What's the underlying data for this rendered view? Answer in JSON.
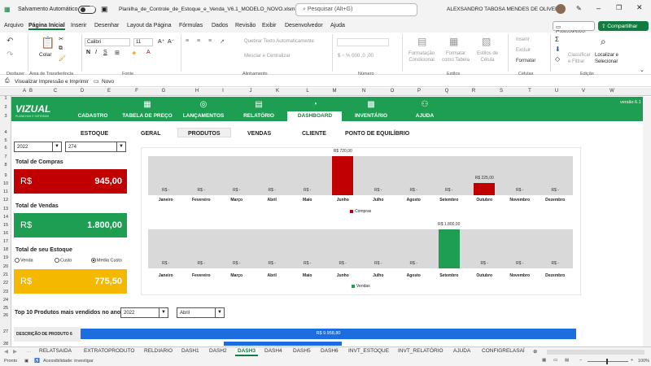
{
  "titlebar": {
    "autosave_label": "Salvamento Automático",
    "file_name": "Planilha_de_Controle_de_Estoque_e_Venda_V6.1_MODELO_NOVO.xlsm",
    "search_placeholder": "Pesquisar (Alt+G)",
    "user_name": "ALEXSANDRO TABOSA MENDES DE OLIVEIRA"
  },
  "menu": [
    "Arquivo",
    "Página Inicial",
    "Inserir",
    "Desenhar",
    "Layout da Página",
    "Fórmulas",
    "Dados",
    "Revisão",
    "Exibir",
    "Desenvolvedor",
    "Ajuda"
  ],
  "menu_active_index": 1,
  "comments_label": "Comentários",
  "share_label": "Compartilhar",
  "ribbon": {
    "paste_label": "Colar",
    "font_name": "Calibri",
    "font_size": "11",
    "wrap_text": "Quebrar Texto Automaticamente",
    "merge_center": "Mesclar e Centralizar",
    "cond_format": "Formatação Condicional",
    "format_table": "Formatar como Tabela",
    "cell_styles": "Estilos de Célula",
    "insert": "Inserir",
    "delete": "Excluir",
    "format": "Formatar",
    "sort_filter": "Classificar e Filtrar",
    "find_select": "Localizar e Selecionar",
    "groups": [
      "Desfazer",
      "Área de Transferência",
      "Fonte",
      "Alinhamento",
      "Número",
      "Estilos",
      "Células",
      "Edição"
    ]
  },
  "quickbar": {
    "print_preview": "Visualizar Impressão e Imprimir",
    "new": "Novo"
  },
  "columns": [
    "A",
    "B",
    "C",
    "D",
    "E",
    "F",
    "G",
    "H",
    "I",
    "J",
    "K",
    "L",
    "M",
    "N",
    "O",
    "P",
    "Q",
    "R",
    "S",
    "T",
    "U",
    "V",
    "W"
  ],
  "rows": [
    "1",
    "2",
    "3",
    "4",
    "5",
    "6",
    "7",
    "8",
    "9",
    "10",
    "11",
    "12",
    "13",
    "14",
    "15",
    "16",
    "17",
    "18",
    "19",
    "20",
    "21",
    "22",
    "23",
    "24",
    "25",
    "26",
    "27",
    "28"
  ],
  "app": {
    "logo": "VIZUAL",
    "logo_sub": "PLANILHAS E SISTEMAS",
    "version": "versão 6.1"
  },
  "nav": [
    {
      "label": "CADASTRO",
      "icon": "pencil-icon"
    },
    {
      "label": "TABELA DE PREÇO",
      "icon": "table-icon"
    },
    {
      "label": "LANÇAMENTOS",
      "icon": "target-icon"
    },
    {
      "label": "RELATÓRIO",
      "icon": "document-icon"
    },
    {
      "label": "DASHBOARD",
      "icon": "pie-chart-icon"
    },
    {
      "label": "INVENTÁRIO",
      "icon": "boxes-icon"
    },
    {
      "label": "AJUDA",
      "icon": "people-icon"
    }
  ],
  "nav_active_index": 4,
  "subtabs": [
    "ESTOQUE",
    "GERAL",
    "PRODUTOS",
    "VENDAS",
    "CLIENTE",
    "PONTO DE EQUILÍBRIO"
  ],
  "subtab_active_index": 2,
  "filters": {
    "year": "2022",
    "product": "274"
  },
  "kpis": {
    "compras": {
      "label": "Total de Compras",
      "currency": "R$",
      "value": "945,00",
      "color": "#c00000"
    },
    "vendas": {
      "label": "Total de Vendas",
      "currency": "R$",
      "value": "1.800,00",
      "color": "#1e9e52"
    },
    "estoque": {
      "label": "Total de seu Estoque",
      "currency": "R$",
      "value": "775,50",
      "color": "#f5b800"
    }
  },
  "radio": {
    "options": [
      "Venda",
      "Custo",
      "Media Custo"
    ],
    "selected_index": 2
  },
  "chart_data": [
    {
      "type": "bar",
      "categories": [
        "Janeiro",
        "Fevereiro",
        "Março",
        "Abril",
        "Maio",
        "Junho",
        "Julho",
        "Agosto",
        "Setembro",
        "Outubro",
        "Novembro",
        "Dezembro"
      ],
      "series": [
        {
          "name": "Compras",
          "values": [
            0,
            0,
            0,
            0,
            0,
            720,
            0,
            0,
            0,
            225,
            0,
            0
          ],
          "color": "#c00000"
        }
      ],
      "labels": [
        "R$ -",
        "R$ -",
        "R$ -",
        "R$ -",
        "R$ -",
        "R$ 720,00",
        "R$ -",
        "R$ -",
        "R$ -",
        "R$ 225,00",
        "R$ -",
        "R$ -"
      ],
      "ylim": [
        0,
        720
      ]
    },
    {
      "type": "bar",
      "categories": [
        "Janeiro",
        "Fevereiro",
        "Março",
        "Abril",
        "Maio",
        "Junho",
        "Julho",
        "Agosto",
        "Setembro",
        "Outubro",
        "Novembro",
        "Dezembro"
      ],
      "series": [
        {
          "name": "Vendas",
          "values": [
            0,
            0,
            0,
            0,
            0,
            0,
            0,
            0,
            1800,
            0,
            0,
            0
          ],
          "color": "#1e9e52"
        }
      ],
      "labels": [
        "R$ -",
        "R$ -",
        "R$ -",
        "R$ -",
        "R$ -",
        "R$ -",
        "R$ -",
        "R$ -",
        "R$ 1.800,00",
        "R$ -",
        "R$ -",
        "R$ -"
      ],
      "ylim": [
        0,
        1800
      ]
    }
  ],
  "top10": {
    "label": "Top 10 Produtos mais vendidos no ano",
    "year": "2022",
    "month": "Abril",
    "item_desc": "DESCRIÇÃO DE PRODUTO 6",
    "item_value": "R$ 9.958,80"
  },
  "sheets": [
    "RELATSAIDA",
    "EXTRATOPRODUTO",
    "RELDIARIO",
    "DASH1",
    "DASH2",
    "DASH3",
    "DASH4",
    "DASH5",
    "DASH6",
    "INVT_ESTOQUE",
    "INVT_RELATÓRIO",
    "AJUDA",
    "CONFIGRELASAÍ"
  ],
  "sheet_active_index": 5,
  "status": {
    "ready": "Pronto",
    "accessibility": "Acessibilidade: investigar",
    "zoom": "100%"
  }
}
